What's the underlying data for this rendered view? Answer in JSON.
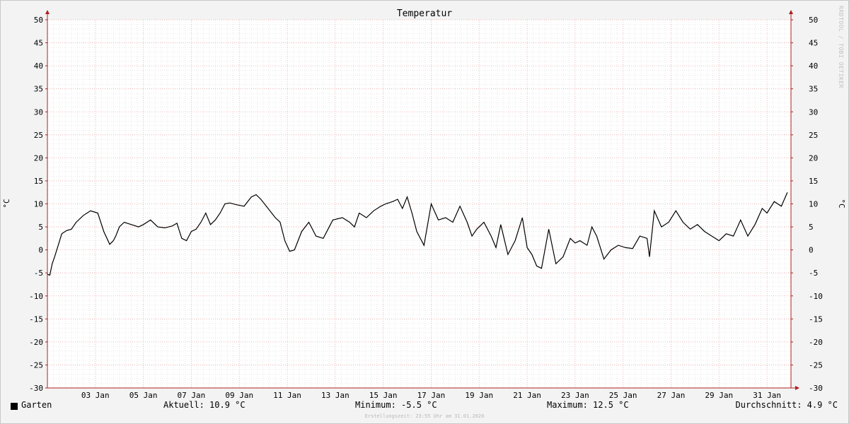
{
  "chart_data": {
    "type": "line",
    "title": "Temperatur",
    "ylabel": "°C",
    "ylabel_right": "°C",
    "xlabel": "",
    "ylim": [
      -30,
      50
    ],
    "y_ticks": [
      50,
      45,
      40,
      35,
      30,
      25,
      20,
      15,
      10,
      5,
      0,
      -5,
      -10,
      -15,
      -20,
      -25,
      -30
    ],
    "x_ticks": [
      "03 Jan",
      "05 Jan",
      "07 Jan",
      "09 Jan",
      "11 Jan",
      "13 Jan",
      "15 Jan",
      "17 Jan",
      "19 Jan",
      "21 Jan",
      "23 Jan",
      "25 Jan",
      "27 Jan",
      "29 Jan",
      "31 Jan"
    ],
    "x_tick_days": [
      3,
      5,
      7,
      9,
      11,
      13,
      15,
      17,
      19,
      21,
      23,
      25,
      27,
      29,
      31
    ],
    "xlim_days": [
      1.0,
      32.0
    ],
    "grid": true,
    "series": [
      {
        "name": "Garten",
        "color": "#000000",
        "x_days": [
          1.0,
          1.1,
          1.2,
          1.3,
          1.45,
          1.6,
          1.8,
          2.0,
          2.2,
          2.5,
          2.8,
          3.1,
          3.35,
          3.6,
          3.75,
          3.85,
          4.0,
          4.2,
          4.5,
          4.8,
          5.0,
          5.3,
          5.6,
          5.9,
          6.2,
          6.4,
          6.6,
          6.8,
          7.0,
          7.2,
          7.4,
          7.6,
          7.8,
          8.0,
          8.2,
          8.4,
          8.6,
          8.9,
          9.2,
          9.5,
          9.7,
          9.9,
          10.2,
          10.5,
          10.7,
          10.9,
          11.1,
          11.3,
          11.6,
          11.9,
          12.2,
          12.5,
          12.9,
          13.3,
          13.6,
          13.8,
          14.0,
          14.3,
          14.6,
          14.9,
          15.1,
          15.4,
          15.6,
          15.8,
          16.0,
          16.2,
          16.4,
          16.7,
          17.0,
          17.3,
          17.6,
          17.9,
          18.2,
          18.5,
          18.7,
          18.9,
          19.2,
          19.5,
          19.7,
          19.9,
          20.2,
          20.5,
          20.8,
          21.0,
          21.2,
          21.4,
          21.6,
          21.9,
          22.2,
          22.5,
          22.8,
          23.0,
          23.2,
          23.5,
          23.7,
          23.9,
          24.2,
          24.5,
          24.8,
          25.1,
          25.4,
          25.7,
          26.0,
          26.1,
          26.3,
          26.6,
          26.9,
          27.2,
          27.5,
          27.8,
          28.1,
          28.4,
          28.7,
          29.0,
          29.3,
          29.6,
          29.9,
          30.2,
          30.5,
          30.8,
          31.0,
          31.3,
          31.6,
          31.85
        ],
        "values": [
          -5.3,
          -5.5,
          -3.0,
          -1.5,
          1.0,
          3.5,
          4.2,
          4.5,
          6.0,
          7.5,
          8.5,
          8.0,
          4.0,
          1.2,
          2.0,
          3.0,
          5.0,
          6.0,
          5.5,
          5.0,
          5.5,
          6.5,
          5.0,
          4.8,
          5.2,
          5.8,
          2.5,
          2.0,
          4.0,
          4.5,
          6.0,
          8.0,
          5.5,
          6.5,
          8.0,
          10.0,
          10.2,
          9.8,
          9.5,
          11.5,
          12.0,
          11.0,
          9.0,
          7.0,
          6.0,
          2.0,
          -0.3,
          0.0,
          4.0,
          6.0,
          3.0,
          2.5,
          6.5,
          7.0,
          6.0,
          5.0,
          8.0,
          7.0,
          8.5,
          9.5,
          10.0,
          10.5,
          11.0,
          9.0,
          11.5,
          8.0,
          4.0,
          1.0,
          10.0,
          6.5,
          7.0,
          6.0,
          9.5,
          6.0,
          3.0,
          4.5,
          6.0,
          3.0,
          0.5,
          5.5,
          -1.0,
          2.0,
          7.0,
          0.5,
          -1.0,
          -3.5,
          -4.0,
          4.5,
          -3.0,
          -1.5,
          2.5,
          1.5,
          2.0,
          1.0,
          5.0,
          3.0,
          -2.0,
          0.0,
          1.0,
          0.5,
          0.3,
          3.0,
          2.5,
          -1.5,
          8.5,
          5.0,
          6.0,
          8.5,
          6.0,
          4.5,
          5.5,
          4.0,
          3.0,
          2.0,
          3.5,
          3.0,
          6.5,
          3.0,
          5.5,
          9.0,
          8.0,
          10.5,
          9.5,
          12.5,
          11.0
        ]
      }
    ]
  },
  "legend": {
    "swatch_color": "#000000",
    "label": "Garten"
  },
  "stats": {
    "current": "Aktuell: 10.9 °C",
    "minimum": "Minimum: -5.5 °C",
    "maximum": "Maximum: 12.5 °C",
    "average": "Durchschnitt: 4.9 °C"
  },
  "footer": "Erstellungszeit: 23:55 Uhr am 31.01.2020",
  "watermark": "RRDTOOL / TOBI OETIKER",
  "colors": {
    "background": "#f3f3f3",
    "plot_background": "#ffffff",
    "major_grid": "#e6a6a6",
    "minor_grid": "#dddddd",
    "axis": "#b02020",
    "line": "#000000"
  }
}
